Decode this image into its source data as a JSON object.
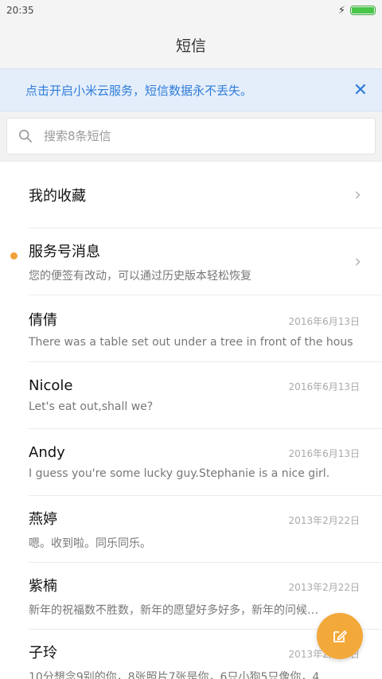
{
  "status_bar": {
    "time": "20:35"
  },
  "title": "短信",
  "banner": {
    "text": "点击开启小米云服务，短信数据永不丢失。"
  },
  "search": {
    "placeholder": "搜索8条短信"
  },
  "items": [
    {
      "name": "我的收藏",
      "preview": "",
      "date": "",
      "chevron": true,
      "unread": false
    },
    {
      "name": "服务号消息",
      "preview": "您的便签有改动，可以通过历史版本轻松恢复",
      "date": "",
      "chevron": true,
      "unread": true
    },
    {
      "name": "倩倩",
      "preview": "There was a table set out under a tree in front of the hous",
      "date": "2016年6月13日",
      "chevron": false,
      "unread": false
    },
    {
      "name": "Nicole",
      "preview": "Let's eat out,shall we?",
      "date": "2016年6月13日",
      "chevron": false,
      "unread": false
    },
    {
      "name": "Andy",
      "preview": "I guess you're some lucky guy.Stephanie is a nice girl.",
      "date": "2016年6月13日",
      "chevron": false,
      "unread": false
    },
    {
      "name": "燕婷",
      "preview": "嗯。收到啦。同乐同乐。",
      "date": "2013年2月22日",
      "chevron": false,
      "unread": false
    },
    {
      "name": "紫楠",
      "preview": "新年的祝福数不胜数，新年的愿望好多好多，新年的问候…",
      "date": "2013年2月22日",
      "chevron": false,
      "unread": false
    },
    {
      "name": "子玲",
      "preview": "10分想念9别的你，8张照片7张是你，6只小狗5只像你，4…",
      "date": "2013年2月22日",
      "chevron": false,
      "unread": false
    }
  ],
  "colors": {
    "accent": "#2f7cd8",
    "fab": "#f3a93a",
    "unread_dot": "#f2a23a",
    "battery": "#49c549"
  }
}
